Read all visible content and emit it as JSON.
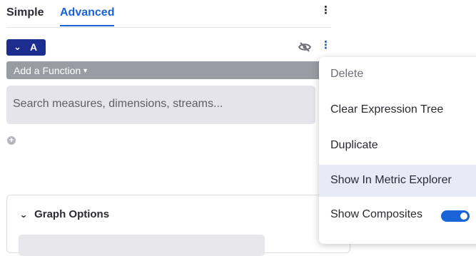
{
  "tabs": {
    "simple": "Simple",
    "advanced": "Advanced"
  },
  "query": {
    "letter": "A",
    "chevron_icon": "chevron-down-icon",
    "visibility_icon": "eye-off-icon"
  },
  "function_button": {
    "label": "Add a Function"
  },
  "search": {
    "placeholder": "Search measures, dimensions, streams..."
  },
  "graph_options": {
    "title": "Graph Options"
  },
  "menu": {
    "delete": "Delete",
    "clear": "Clear Expression Tree",
    "duplicate": "Duplicate",
    "explorer": "Show In Metric Explorer",
    "composites": "Show Composites",
    "composites_enabled": true
  },
  "colors": {
    "accent": "#1a63d6",
    "badge": "#1c2d8f",
    "function_bar": "#9a9ca4",
    "menu_highlight": "#e8ebf6"
  }
}
